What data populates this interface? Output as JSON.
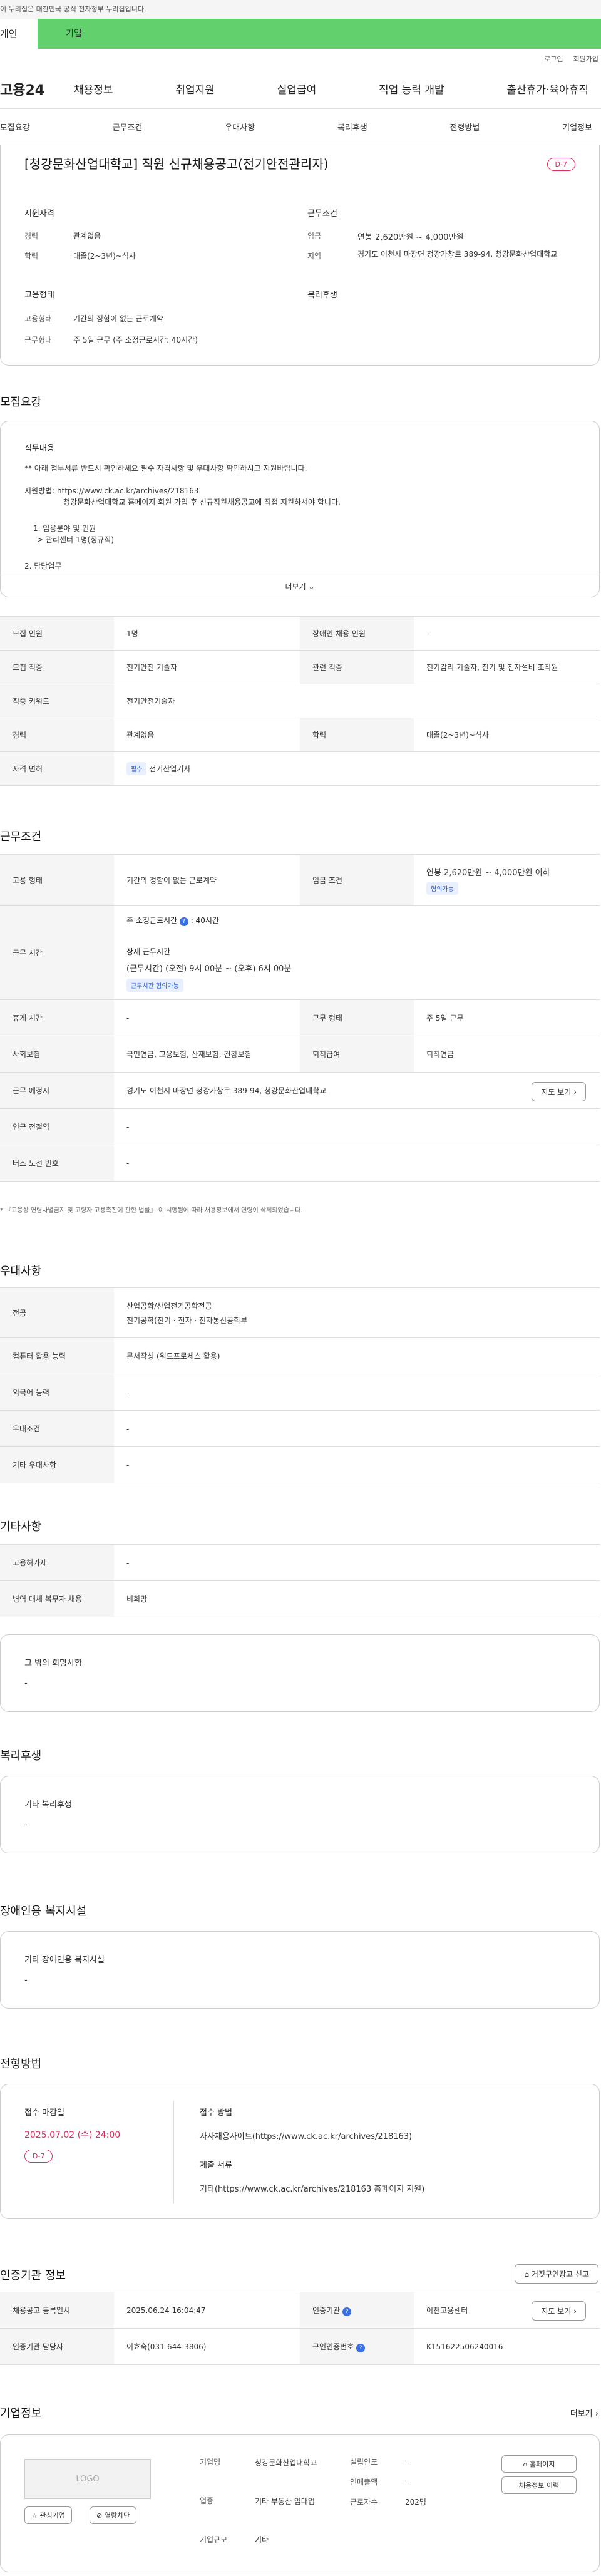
{
  "topbar": {
    "notice": "이 누리집은 대한민국 공식 전자정부 누리집입니다."
  },
  "tabbar": {
    "left": "개인",
    "right": "기업"
  },
  "utility": {
    "login": "로그인",
    "join": "회원가입"
  },
  "gnb": {
    "logo": "고용24",
    "menu": [
      "채용정보",
      "취업지원",
      "실업급여",
      "직업 능력 개발",
      "출산휴가·육아휴직"
    ]
  },
  "subtabs": [
    "모집요강",
    "근무조건",
    "우대사항",
    "복리후생",
    "전형방법",
    "기업정보"
  ],
  "job": {
    "title": "[청강문화산업대학교] 직원 신규채용공고(전기안전관리자)",
    "dday": "D-7",
    "qual_title": "지원자격",
    "career_k": "경력",
    "career_v": "관계없음",
    "edu_k": "학력",
    "edu_v": "대졸(2~3년)~석사",
    "cond_title": "근무조건",
    "wage_k": "임금",
    "wage_v": "연봉 2,620만원 ~ 4,000만원",
    "loc_k": "지역",
    "loc_v": "경기도 이천시 마장면 청강가창로 389-94, 청강문화산업대학교",
    "emp_title": "고용형태",
    "emptype_k": "고용형태",
    "emptype_v": "기간의 정함이 없는 근로계약",
    "worktype_k": "근무형태",
    "worktype_v": "주 5일 근무 (주 소정근로시간: 40시간)",
    "welfare_title": "복리후생"
  },
  "recruit": {
    "section": "모집요강",
    "duty_title": "직무내용",
    "line1": "** 아래 첨부서류 반드시 확인하세요 필수 자격사항 및 우대사항 확인하시고 지원바랍니다.",
    "line2": "지원방법: https://www.ck.ac.kr/archives/218163",
    "line3": "청강문화산업대학교 홈페이지 회원 가입 후 신규직원채용공고에 직접 지원하셔야 합니다.",
    "line4": "1. 임용분야 및 인원",
    "line5": "> 관리센터 1명(정규직)",
    "line6": "2. 담당업무",
    "more": "더보기"
  },
  "recruit_table": {
    "headcount_k": "모집 인원",
    "headcount_v": "1명",
    "disabled_k": "장애인 채용 인원",
    "disabled_v": "-",
    "job_k": "모집 직종",
    "job_v": "전기안전 기술자",
    "related_k": "관련 직종",
    "related_v": "전기감리 기술자, 전기 및 전자설비 조작원",
    "keyword_k": "직종 키워드",
    "keyword_v": "전기안전기술자",
    "career_k": "경력",
    "career_v": "관계없음",
    "edu_k": "학력",
    "edu_v": "대졸(2~3년)~석사",
    "license_k": "자격 면허",
    "license_badge": "필수",
    "license_v": "전기산업기사"
  },
  "conditions": {
    "section": "근무조건",
    "emptype_k": "고용 형태",
    "emptype_v": "기간의 정함이 없는 근로계약",
    "wage_k": "임금 조건",
    "wage_v": "연봉 2,620만원 ~ 4,000만원 이하",
    "wage_badge": "협의가능",
    "worktime_k": "근무 시간",
    "worktime_main": "주 소정근로시간",
    "worktime_hours": "40시간",
    "detail_title": "상세 근무시간",
    "detail_v": "(근무시간) (오전) 9시 00분 ~ (오후) 6시 00분",
    "detail_badge": "근무시간 협의가능",
    "rest_k": "휴게 시간",
    "rest_v": "-",
    "form_k": "근무 형태",
    "form_v": "주 5일 근무",
    "insurance_k": "사회보험",
    "insurance_v": "국민연금, 고용보험, 산재보험, 건강보험",
    "retire_k": "퇴직급여",
    "retire_v": "퇴직연금",
    "place_k": "근무 예정지",
    "place_v": "경기도 이천시 마장면 청강가창로 389-94, 청강문화산업대학교",
    "map_btn": "지도 보기",
    "subway_k": "인근 전철역",
    "subway_v": "-",
    "bus_k": "버스 노선 번호",
    "bus_v": "-",
    "note": "* 『고용상 연령차별금지 및 고령자 고용촉진에 관한 법률』 이 시행됨에 따라 채용정보에서 연령이 삭제되었습니다."
  },
  "pref": {
    "section": "우대사항",
    "major_k": "전공",
    "major_v1": "산업공학/산업전기공학전공",
    "major_v2": "전기공학(전기 · 전자 · 전자통신공학부",
    "computer_k": "컴퓨터 활용 능력",
    "computer_v": "문서작성 (워드프로세스 활용)",
    "lang_k": "외국어 능력",
    "lang_v": "-",
    "cond_k": "우대조건",
    "cond_v": "-",
    "other_k": "기타 우대사항",
    "other_v": "-"
  },
  "etc": {
    "section": "기타사항",
    "hire_k": "고용허가제",
    "hire_v": "-",
    "military_k": "병역 대체 복무자 채용",
    "military_v": "비희망",
    "other_title": "그 밖의 희망사항",
    "other_v": "-"
  },
  "welfare": {
    "section": "복리후생",
    "title": "기타 복리후생",
    "v": "-"
  },
  "disability": {
    "section": "장애인용 복지시설",
    "title": "기타 장애인용 복지시설",
    "v": "-"
  },
  "selection": {
    "section": "전형방법",
    "deadline_title": "접수 마감일",
    "deadline": "2025.07.02 (수) 24:00",
    "dday": "D-7",
    "method_title": "접수 방법",
    "method_v": "자사채용사이트(https://www.ck.ac.kr/archives/218163)",
    "docs_title": "제출 서류",
    "docs_v": "기타(https://www.ck.ac.kr/archives/218163 홈페이지 지원)"
  },
  "cert": {
    "section": "인증기관 정보",
    "report_btn": "거짓구인광고 신고",
    "date_k": "채용공고 등록일시",
    "date_v": "2025.06.24 16:04:47",
    "agency_k": "인증기관",
    "agency_v": "이천고용센터",
    "map_btn": "지도 보기",
    "manager_k": "인증기관 담당자",
    "manager_v": "이효숙(031-644-3806)",
    "regno_k": "구인인증번호",
    "regno_v": "K151622506240016"
  },
  "company": {
    "section": "기업정보",
    "more": "더보기",
    "logo": "LOGO",
    "fav_btn": "관심기업",
    "block_btn": "열람차단",
    "name_k": "기업명",
    "name_v": "청강문화산업대학교",
    "industry_k": "업종",
    "industry_v": "기타 부동산 임대업",
    "scale_k": "기업규모",
    "scale_v": "기타",
    "founded_k": "설립연도",
    "founded_v": "-",
    "sales_k": "연매출액",
    "sales_v": "-",
    "staff_k": "근로자수",
    "staff_v": "202명",
    "home_btn": "홈페이지",
    "jobs_btn": "채용정보 이력"
  }
}
